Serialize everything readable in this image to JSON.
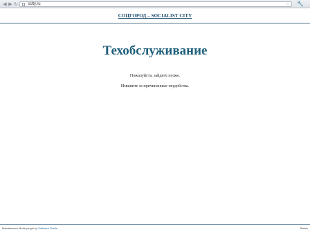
{
  "browser": {
    "back_glyph": "◀",
    "forward_glyph": "▶",
    "reload_glyph": "↻",
    "url": "sclty.ru",
    "star_glyph": "☆",
    "menu_glyph": "🔧"
  },
  "header": {
    "site_title": "СОЦГОРОД – SOCIALIST CITY"
  },
  "main": {
    "heading": "Техобслуживание",
    "message_1": "Пожалуйста, зайдите позже.",
    "message_2": "Извините за причиненные неудобства."
  },
  "footer": {
    "powered_text": "Maintenance Mode plugin by",
    "powered_link": "Software Guide",
    "right_text": "Status"
  },
  "colors": {
    "heading": "#1d5f7a",
    "link": "#1b4a6b",
    "rule": "#4a6f8a"
  }
}
